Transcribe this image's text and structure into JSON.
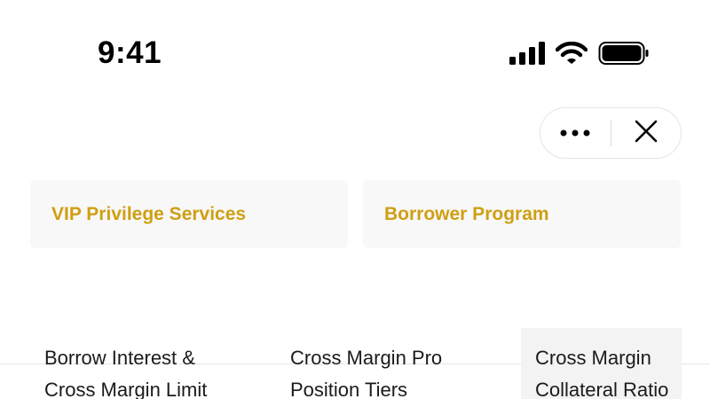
{
  "status_bar": {
    "time": "9:41",
    "icons": [
      "signal-icon",
      "wifi-icon",
      "battery-icon"
    ]
  },
  "capsule": {
    "more_icon": "more-dots-icon",
    "close_icon": "close-icon"
  },
  "cards": [
    {
      "label": "VIP Privilege Services"
    },
    {
      "label": "Borrower Program"
    }
  ],
  "tabs": [
    {
      "line1": "Borrow Interest &",
      "line2": "Cross Margin Limit"
    },
    {
      "line1": "Cross Margin Pro",
      "line2": "Position Tiers"
    },
    {
      "line1": "Cross Margin",
      "line2": "Collateral Ratio",
      "selected": true
    }
  ],
  "colors": {
    "accent": "#cf9f13",
    "card_bg": "#f8f8f8",
    "selected_tab_bg": "#f3f3f3"
  }
}
